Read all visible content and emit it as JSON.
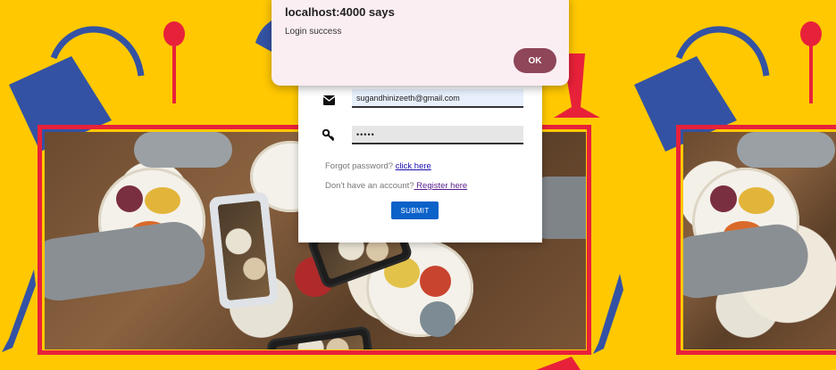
{
  "dialog": {
    "title": "localhost:4000 says",
    "message": "Login success",
    "ok_label": "OK"
  },
  "login": {
    "email_value": "sugandhinizeeth@gmail.com",
    "password_value": "•••••",
    "forgot_text": "Forgot password?",
    "forgot_link": "click here",
    "register_text": "Don't have an account?",
    "register_link": " Register here",
    "submit_label": "SUBMIT"
  },
  "icons": {
    "email": "envelope-icon",
    "password": "key-icon"
  },
  "colors": {
    "background": "#ffc800",
    "frame": "#e8213a",
    "dialog_bg": "#fbeef3",
    "ok_button": "#8e4658",
    "submit_button": "#0b62c9",
    "bag_blue": "#3452a4"
  }
}
